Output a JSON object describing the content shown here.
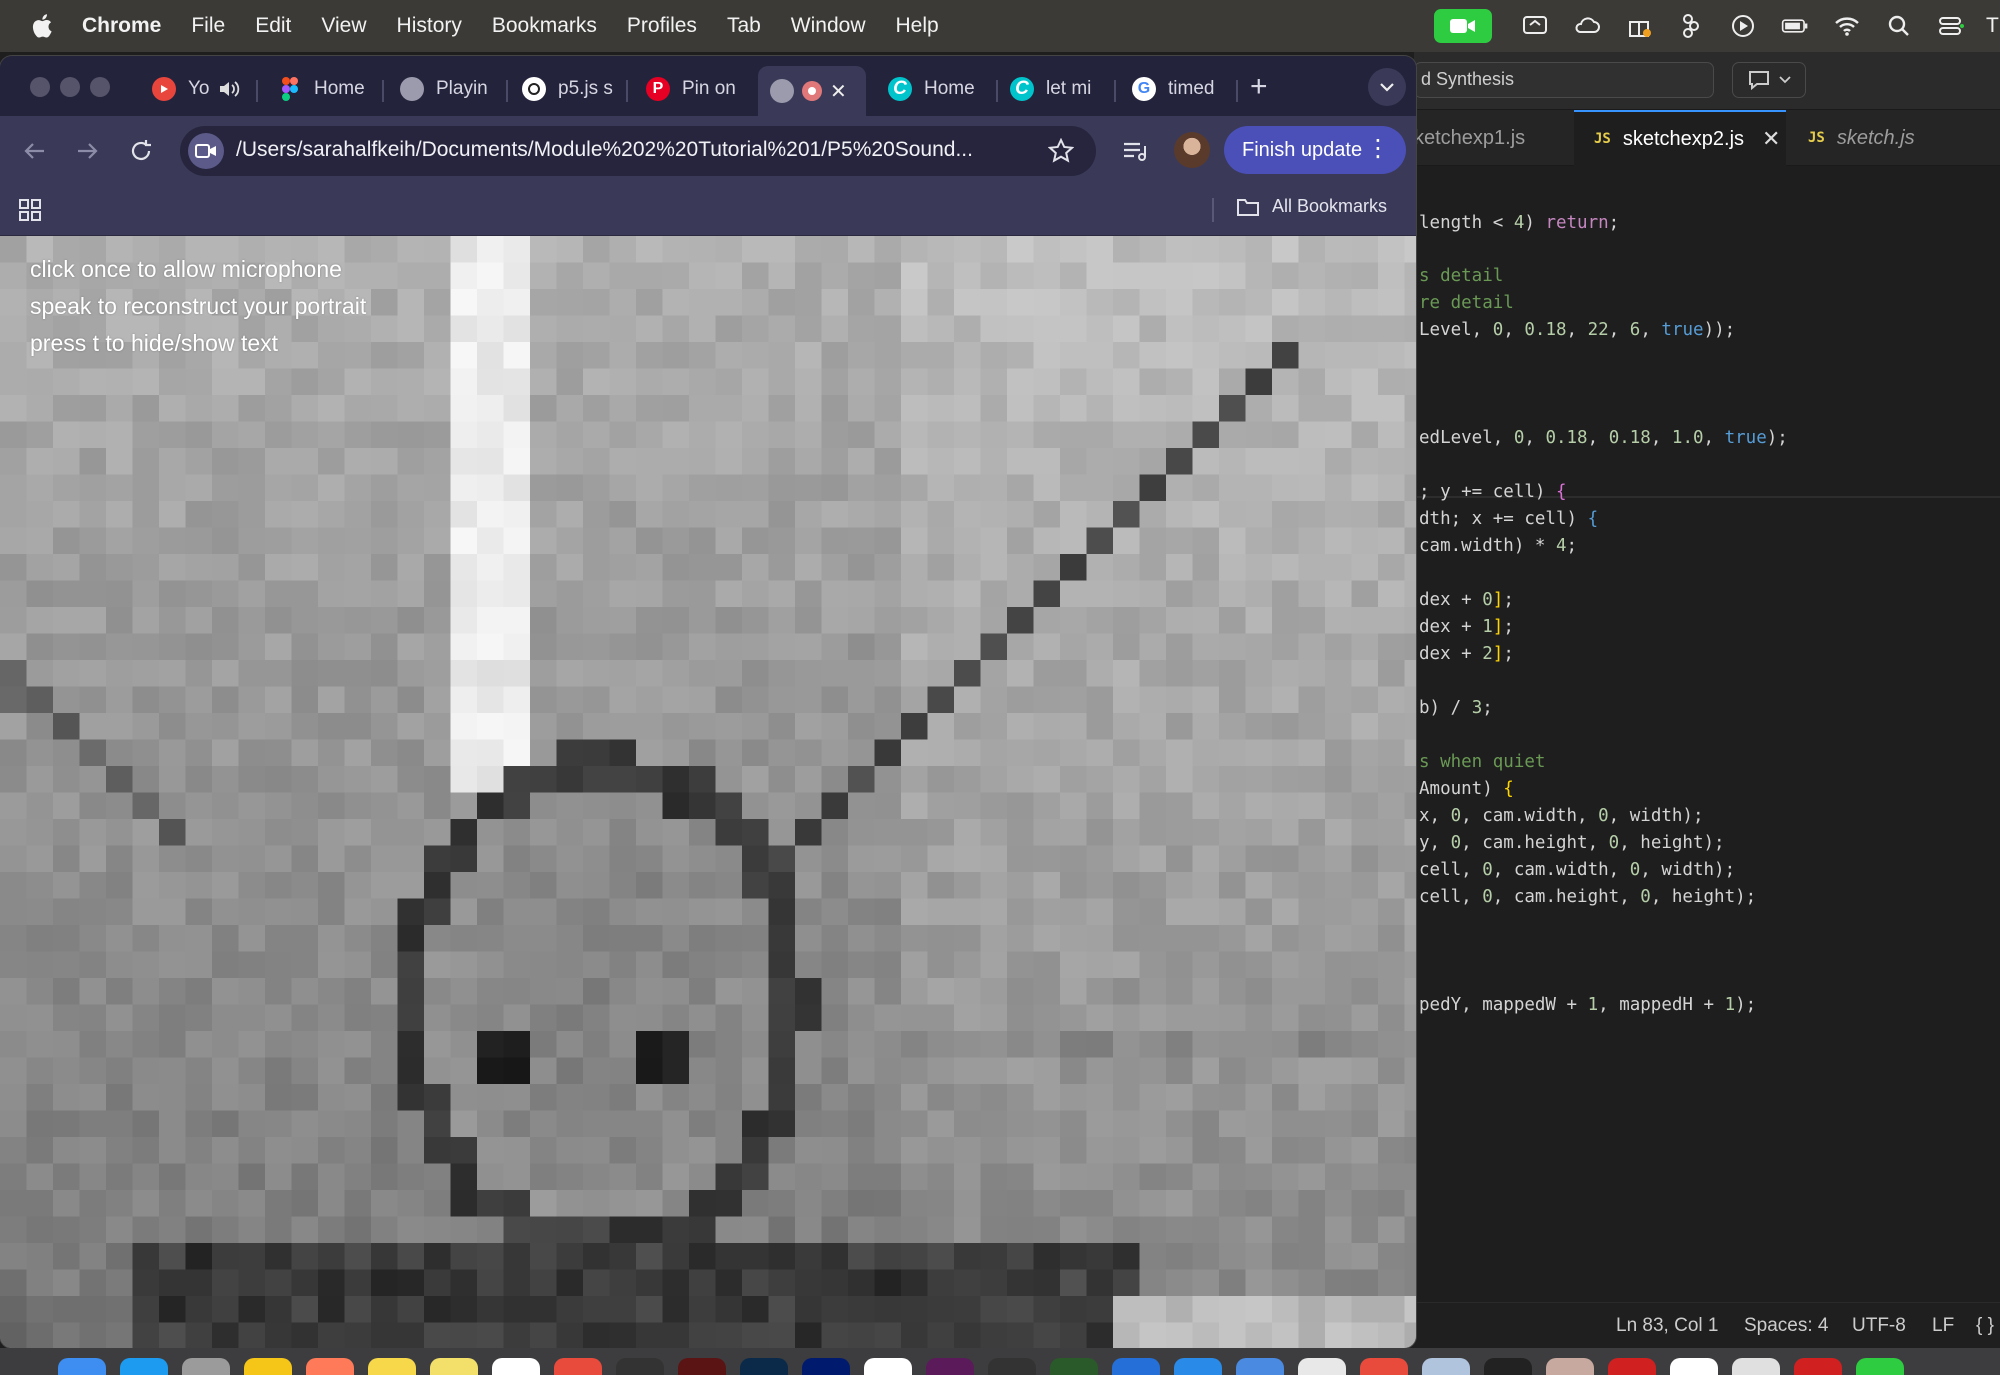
{
  "menubar": {
    "items": [
      "Chrome",
      "File",
      "Edit",
      "View",
      "History",
      "Bookmarks",
      "Profiles",
      "Tab",
      "Window",
      "Help"
    ],
    "trailing_letter": "T"
  },
  "icons": {
    "apple": "apple-logo-icon",
    "status": [
      "facetime-icon",
      "screen-share-icon",
      "cloud-icon",
      "gift-icon",
      "figma-icon",
      "play-icon",
      "battery-icon",
      "wifi-icon",
      "search-icon",
      "control-center-icon"
    ]
  },
  "chrome": {
    "tabs": [
      {
        "label": "Yo",
        "favicon_color": "#e8453c",
        "audio": true
      },
      {
        "label": "Home",
        "favicon_color": "#a259ff"
      },
      {
        "label": "Playin",
        "favicon_color": "#c9c9d6"
      },
      {
        "label": "p5.js s",
        "favicon_color": "#ffffff"
      },
      {
        "label": "Pin on",
        "favicon_color": "#e60023"
      },
      {
        "label": "",
        "favicon_color": "#c9c9d6",
        "active": true,
        "recording": true
      },
      {
        "label": "Home",
        "favicon_color": "#00c4cc"
      },
      {
        "label": "let mi",
        "favicon_color": "#00c4cc"
      },
      {
        "label": "timed",
        "favicon_color": "#4285f4"
      }
    ],
    "address": "/Users/sarahalfkeih/Documents/Module%202%20Tutorial%201/P5%20Sound...",
    "finish_update": "Finish update",
    "all_bookmarks": "All Bookmarks"
  },
  "sketch": {
    "instructions": [
      "click once to allow microphone",
      "speak to reconstruct your portrait",
      "press t to hide/show text"
    ]
  },
  "vscode": {
    "command_center": "d Synthesis",
    "tabs": [
      {
        "label": "ketchexp1.js",
        "active": false
      },
      {
        "label": "sketchexp2.js",
        "active": true
      },
      {
        "label": "sketch.js",
        "active": false,
        "italic": true
      }
    ],
    "js_badge": "JS",
    "status": {
      "position": "Ln 83, Col 1",
      "spaces": "Spaces: 4",
      "encoding": "UTF-8",
      "eol": "LF",
      "lang": "{ }"
    }
  },
  "colors": {
    "accent": "#4b50b8",
    "facetime": "#2ecc40",
    "vs_blue": "#3794ff"
  }
}
